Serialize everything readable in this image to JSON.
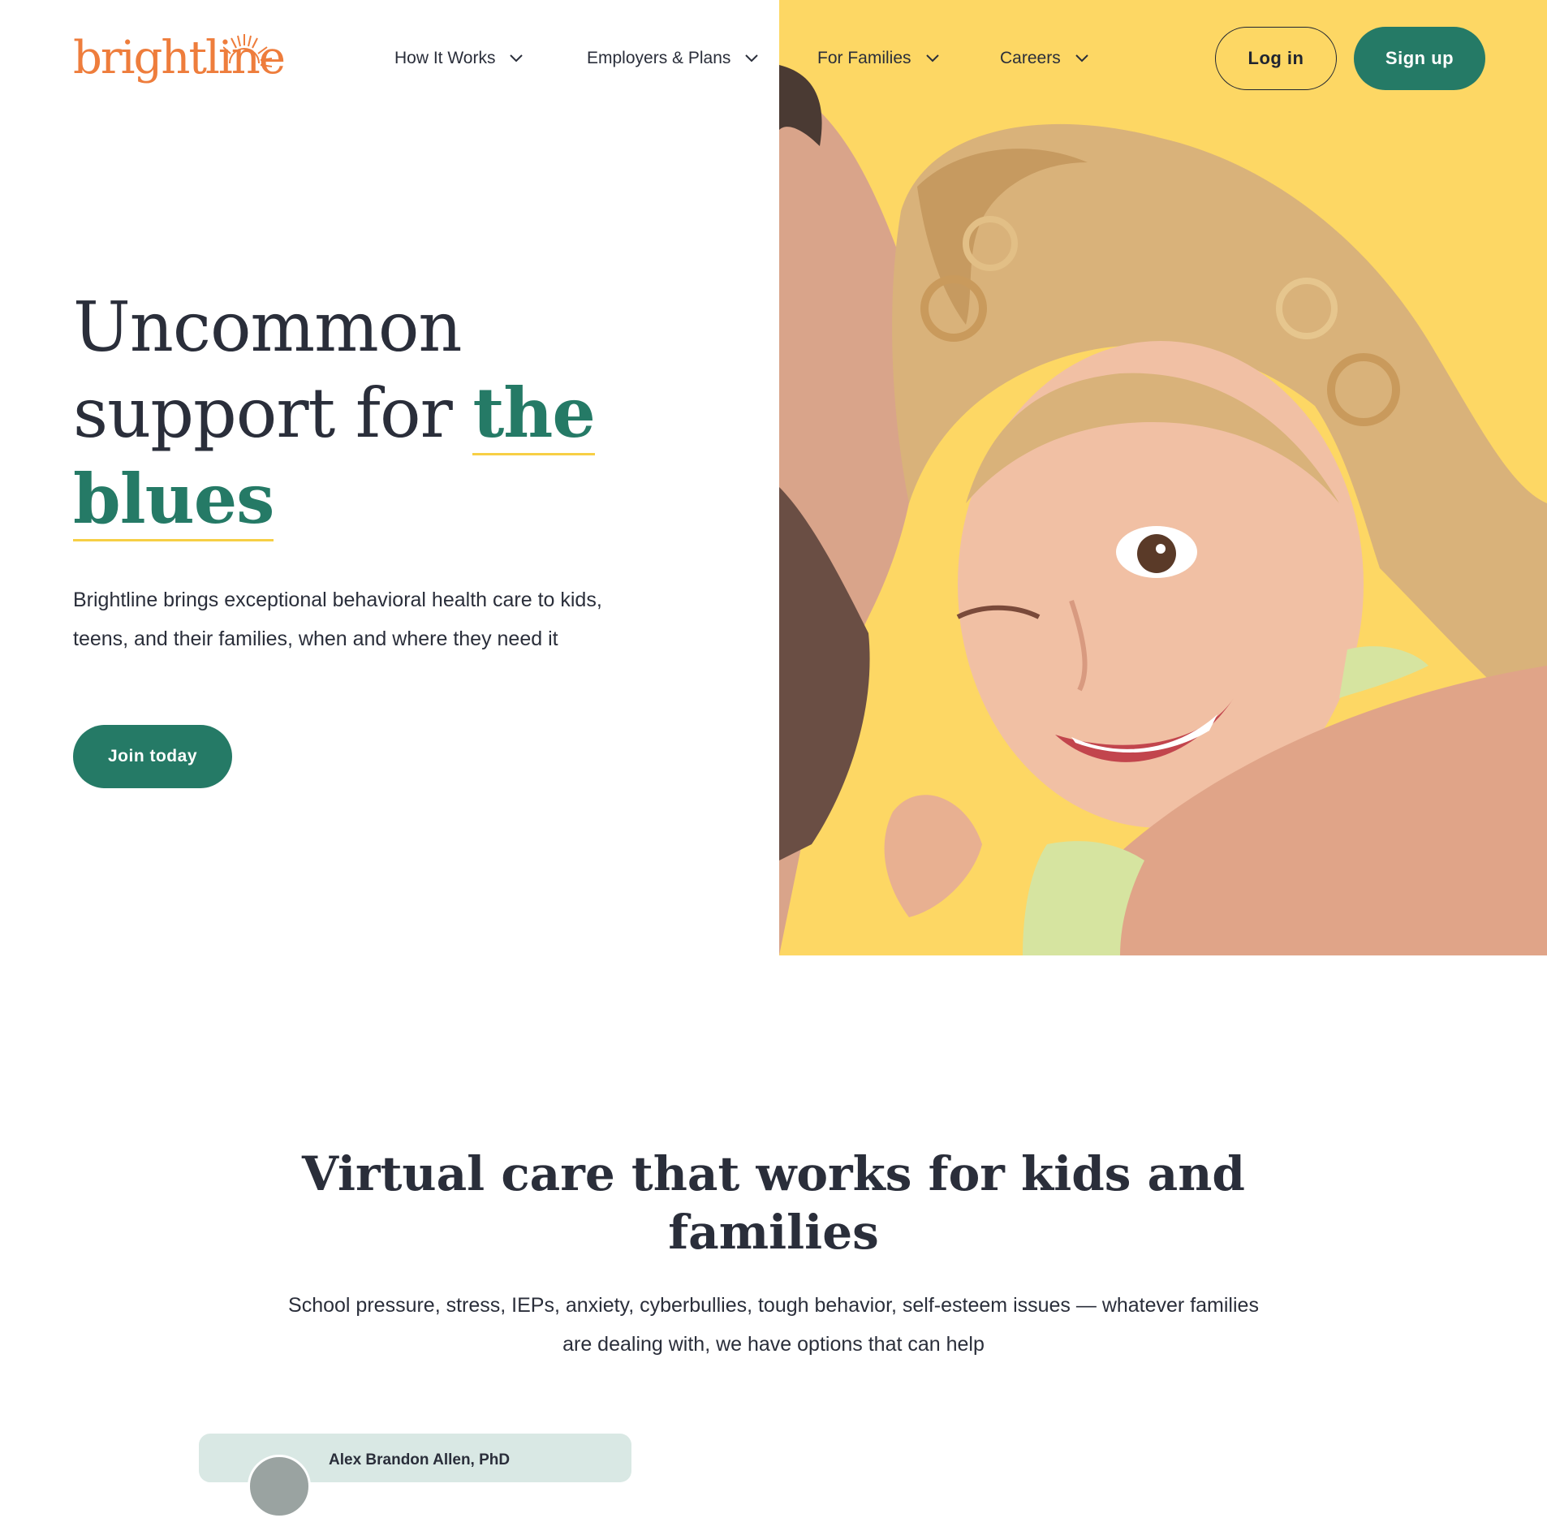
{
  "brand": {
    "logo_text": "brightline",
    "logo_color": "#ee7d3c",
    "accent_green": "#257a66",
    "accent_yellow": "#fdd764",
    "underline_yellow": "#f7cf45"
  },
  "nav": {
    "items": [
      {
        "label": "How It Works",
        "icon": "chevron-down-icon"
      },
      {
        "label": "Employers & Plans",
        "icon": "chevron-down-icon"
      },
      {
        "label": "For Families",
        "icon": "chevron-down-icon"
      },
      {
        "label": "Careers",
        "icon": "chevron-down-icon"
      }
    ],
    "login_label": "Log in",
    "signup_label": "Sign up"
  },
  "hero": {
    "headline_plain_1": "Uncommon",
    "headline_plain_2": "support for ",
    "headline_accent_1": "the",
    "headline_accent_2": "blues",
    "subtext": "Brightline brings exceptional behavioral health care to kids, teens, and their families, when and where they need it",
    "cta_label": "Join today"
  },
  "section": {
    "title": "Virtual care that works for kids and families",
    "subtitle": "School pressure, stress, IEPs, anxiety, cyberbullies, tough behavior, self-esteem issues — whatever families are dealing with, we have options that can help"
  },
  "card": {
    "name": "Alex Brandon Allen, PhD"
  }
}
